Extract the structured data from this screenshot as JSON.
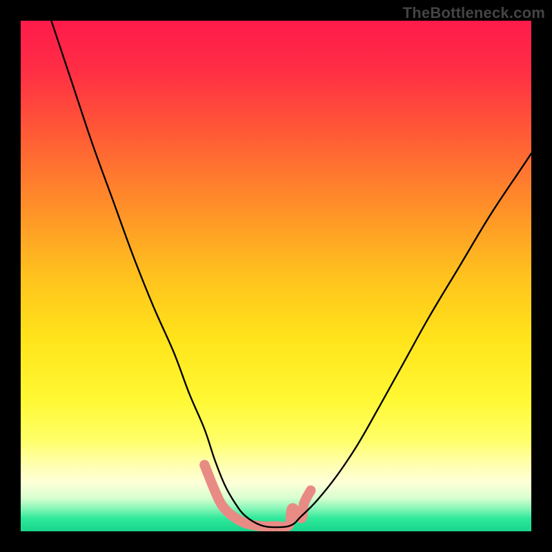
{
  "watermark": "TheBottleneck.com",
  "gradient": {
    "stops": [
      {
        "offset": 0.0,
        "color": "#ff1a4b"
      },
      {
        "offset": 0.1,
        "color": "#ff2f44"
      },
      {
        "offset": 0.22,
        "color": "#ff5a36"
      },
      {
        "offset": 0.35,
        "color": "#ff8a2a"
      },
      {
        "offset": 0.5,
        "color": "#ffc21e"
      },
      {
        "offset": 0.62,
        "color": "#ffe31a"
      },
      {
        "offset": 0.74,
        "color": "#fff833"
      },
      {
        "offset": 0.82,
        "color": "#ffff66"
      },
      {
        "offset": 0.87,
        "color": "#ffffb0"
      },
      {
        "offset": 0.905,
        "color": "#fdffd8"
      },
      {
        "offset": 0.935,
        "color": "#d8ffd0"
      },
      {
        "offset": 0.955,
        "color": "#88f7b8"
      },
      {
        "offset": 0.975,
        "color": "#2fe89a"
      },
      {
        "offset": 1.0,
        "color": "#17d68c"
      }
    ]
  },
  "chart_data": {
    "type": "line",
    "title": "",
    "xlabel": "",
    "ylabel": "",
    "xlim": [
      0,
      100
    ],
    "ylim": [
      0,
      100
    ],
    "series": [
      {
        "name": "black-curve",
        "x": [
          6,
          10,
          14,
          18,
          22,
          26,
          30,
          33,
          36,
          38,
          40,
          42,
          44,
          47,
          50,
          53,
          55,
          58,
          62,
          66,
          70,
          75,
          80,
          86,
          92,
          98,
          100
        ],
        "values": [
          100,
          88,
          76,
          65,
          54,
          44,
          35,
          27,
          20,
          14,
          9,
          5.5,
          3,
          1.2,
          0.8,
          1.2,
          3,
          6,
          11,
          17,
          24,
          33,
          42,
          52,
          62,
          71,
          74
        ]
      },
      {
        "name": "salmon-segment",
        "x": [
          36,
          38,
          39.5,
          41.5,
          44,
          47,
          50,
          52.5,
          53.2,
          55,
          55.5,
          56.8
        ],
        "values": [
          13,
          8,
          5,
          3,
          1.6,
          1.0,
          1.0,
          1.2,
          4.5,
          2.6,
          5.5,
          8
        ]
      }
    ],
    "colors": {
      "black-curve": "#000000",
      "salmon-segment": "#e98b85"
    },
    "salmon_marker_radius_px": 7.2
  }
}
